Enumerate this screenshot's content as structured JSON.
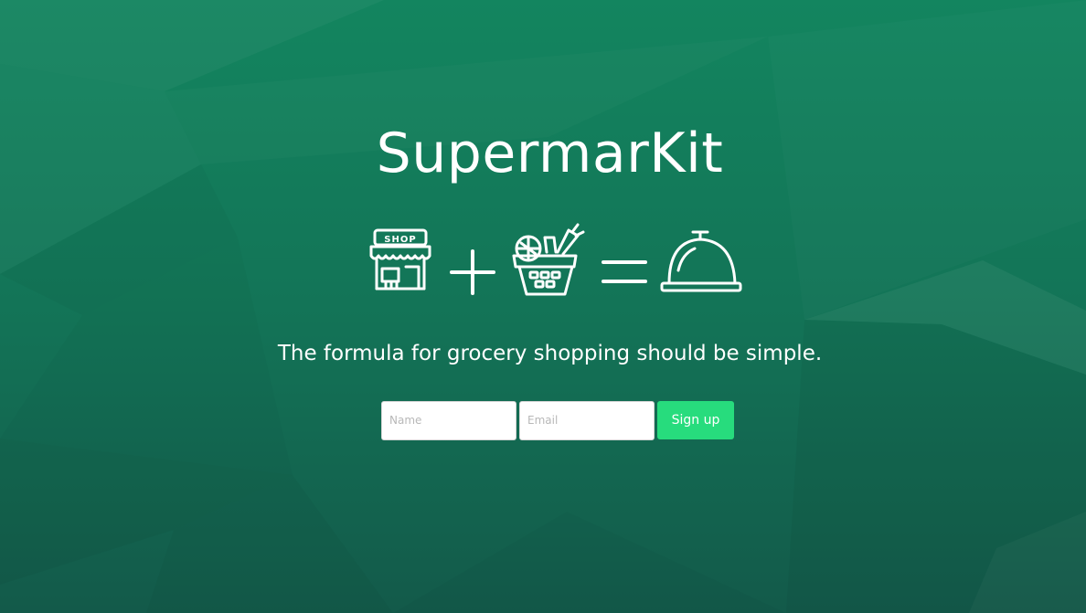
{
  "brand": {
    "title": "SupermarKit"
  },
  "formula": {
    "shop_sign": "SHOP",
    "operator_plus_icon": "plus-icon",
    "operator_equals_icon": "equals-icon",
    "icons": [
      "shop-icon",
      "plus-icon",
      "grocery-basket-icon",
      "equals-icon",
      "serving-cloche-icon"
    ]
  },
  "tagline": "The formula for grocery shopping should be simple.",
  "signup": {
    "name_placeholder": "Name",
    "name_value": "",
    "email_placeholder": "Email",
    "email_value": "",
    "button_label": "Sign up"
  },
  "colors": {
    "background_top": "#13855f",
    "background_bottom": "#135a4a",
    "accent_button": "#27dc7d",
    "text": "#ffffff"
  }
}
